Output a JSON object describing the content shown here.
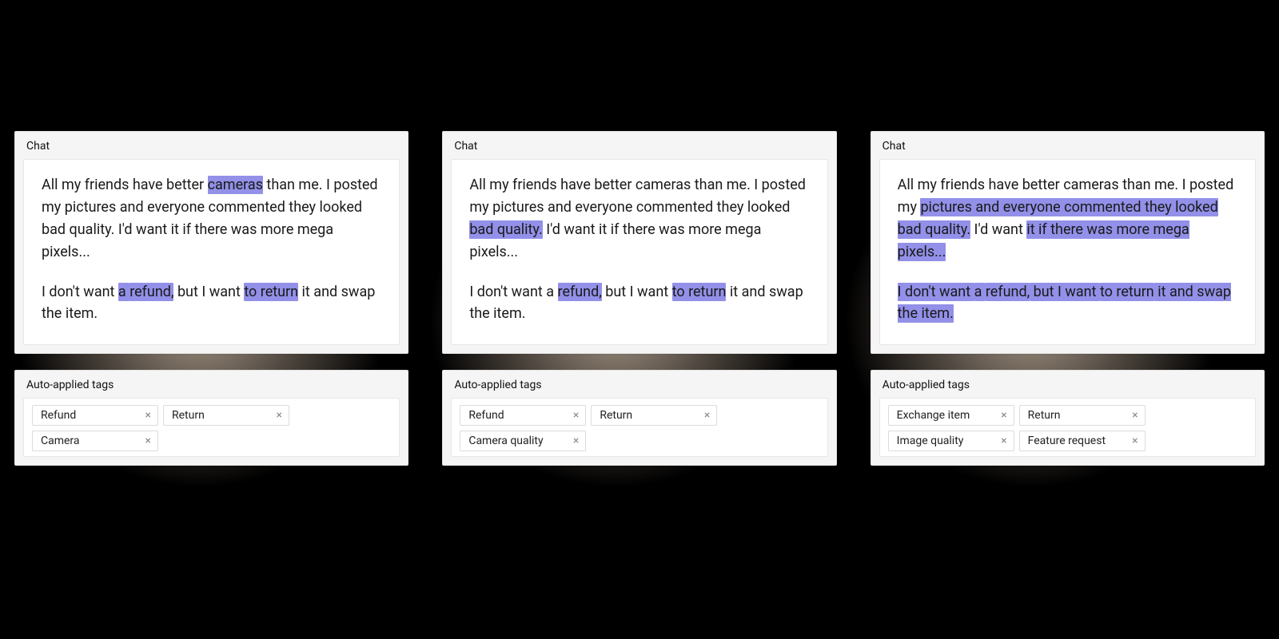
{
  "labels": {
    "chat_header": "Chat",
    "tags_header": "Auto-applied tags"
  },
  "colors": {
    "highlight": "#9290e8",
    "background": "#000000",
    "card_bg": "#f5f5f5",
    "panel_bg": "#ffffff",
    "border": "#e2e2e2"
  },
  "paragraphs": {
    "p1_segments": [
      {
        "text": "All my friends have better "
      },
      {
        "text": "cameras",
        "key": "cameras"
      },
      {
        "text": " than me. I posted my "
      },
      {
        "text": "pictures and everyone commented they looked",
        "key": "pictures_block1"
      },
      {
        "text": " "
      },
      {
        "text": "bad quality.",
        "key": "bad_quality"
      },
      {
        "text": " I'd want "
      },
      {
        "text": "it if there was more mega pixels...",
        "key": "pixels_block"
      }
    ],
    "p2_segments": [
      {
        "text": "I don't want "
      },
      {
        "text": "a ",
        "key": "a_"
      },
      {
        "text": "refund,",
        "key": "refund"
      },
      {
        "text": " but I want "
      },
      {
        "text": "to return",
        "key": "to_return"
      },
      {
        "text": " it and swap the item.",
        "key": "tail"
      }
    ]
  },
  "examples": [
    {
      "p1_highlight_keys": [
        "cameras"
      ],
      "p2_highlight_keys": [
        "a_",
        "refund",
        "to_return"
      ],
      "full_p2_highlight": false,
      "tags": [
        "Refund",
        "Return",
        "Camera"
      ]
    },
    {
      "p1_highlight_keys": [
        "bad_quality"
      ],
      "p2_highlight_keys": [
        "refund",
        "to_return"
      ],
      "full_p2_highlight": false,
      "tags": [
        "Refund",
        "Return",
        "Camera quality"
      ]
    },
    {
      "p1_highlight_keys": [
        "pictures_block1",
        "bad_quality",
        "pixels_block"
      ],
      "p2_highlight_keys": [],
      "full_p2_highlight": true,
      "tags": [
        "Exchange item",
        "Return",
        "Image quality",
        "Feature request"
      ]
    }
  ]
}
